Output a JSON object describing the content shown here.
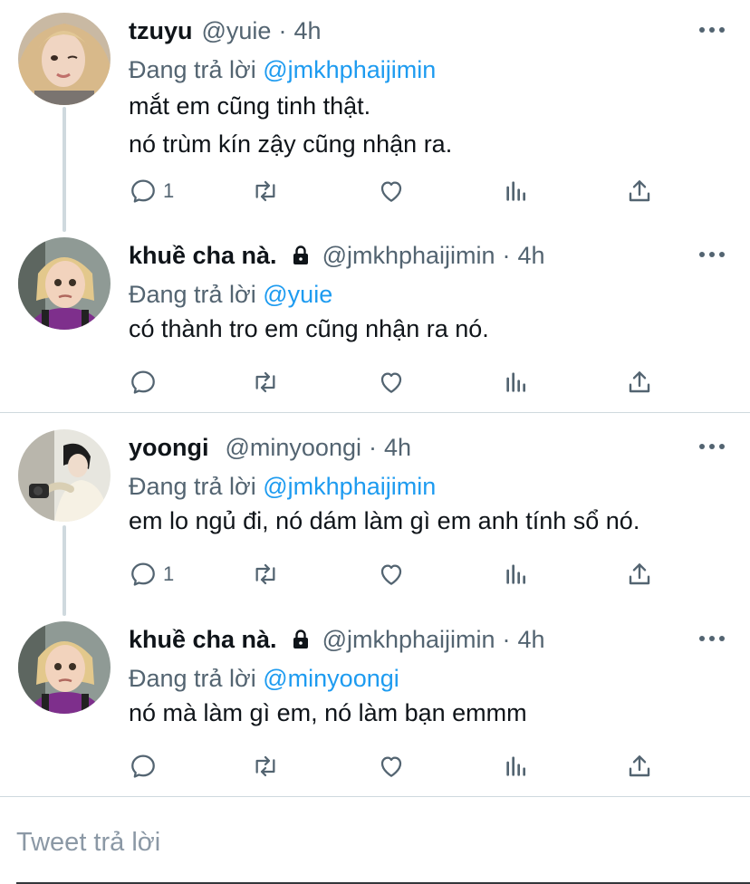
{
  "tweets": [
    {
      "name": "tzuyu",
      "handle": "@yuie",
      "time": "4h",
      "locked": false,
      "reply_prefix": "Đang trả lời ",
      "reply_to": "@jmkhphaijimin",
      "text_lines": [
        "mắt em cũng tinh thật.",
        "nó trùm kín zậy cũng nhận ra."
      ],
      "reply_count": "1"
    },
    {
      "name": "khuề cha nà.",
      "handle": "@jmkhphaijimin",
      "time": "4h",
      "locked": true,
      "reply_prefix": "Đang trả lời ",
      "reply_to": "@yuie",
      "text_lines": [
        "có thành tro em cũng nhận ra nó."
      ],
      "reply_count": ""
    },
    {
      "name": "yoongi",
      "handle": "@minyoongi",
      "time": "4h",
      "locked": false,
      "reply_prefix": "Đang trả lời ",
      "reply_to": "@jmkhphaijimin",
      "text_lines": [
        "em lo ngủ đi, nó dám làm gì em anh tính sổ nó."
      ],
      "reply_count": "1"
    },
    {
      "name": "khuề cha nà.",
      "handle": "@jmkhphaijimin",
      "time": "4h",
      "locked": true,
      "reply_prefix": "Đang trả lời ",
      "reply_to": "@minyoongi",
      "text_lines": [
        "nó mà làm gì em, nó làm bạn emmm"
      ],
      "reply_count": ""
    }
  ],
  "separator": "·",
  "compose": {
    "placeholder": "Tweet trả lời"
  },
  "colors": {
    "accent": "#1d9bf0",
    "secondary_text": "#536471",
    "primary_text": "#0f1419",
    "divider": "#cfd9de"
  }
}
